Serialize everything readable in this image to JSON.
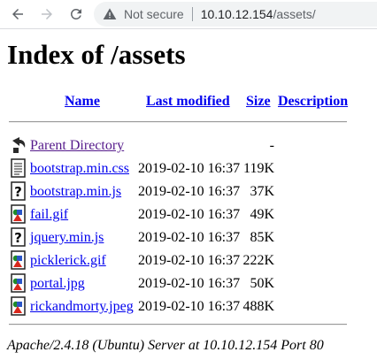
{
  "browser": {
    "security_label": "Not secure",
    "url_host": "10.10.12.154",
    "url_path": "/assets/"
  },
  "page": {
    "title": "Index of /assets",
    "columns": {
      "name": "Name",
      "last_modified": "Last modified",
      "size": "Size",
      "description": "Description"
    },
    "parent": {
      "label": "Parent Directory",
      "size": "-",
      "icon": "back-icon"
    },
    "files": [
      {
        "name": "bootstrap.min.css",
        "modified": "2019-02-10 16:37",
        "size": "119K",
        "icon": "text-file-icon"
      },
      {
        "name": "bootstrap.min.js",
        "modified": "2019-02-10 16:37",
        "size": "37K",
        "icon": "unknown-file-icon"
      },
      {
        "name": "fail.gif",
        "modified": "2019-02-10 16:37",
        "size": "49K",
        "icon": "image-file-icon"
      },
      {
        "name": "jquery.min.js",
        "modified": "2019-02-10 16:37",
        "size": "85K",
        "icon": "unknown-file-icon"
      },
      {
        "name": "picklerick.gif",
        "modified": "2019-02-10 16:37",
        "size": "222K",
        "icon": "image-file-icon"
      },
      {
        "name": "portal.jpg",
        "modified": "2019-02-10 16:37",
        "size": "50K",
        "icon": "image-file-icon"
      },
      {
        "name": "rickandmorty.jpeg",
        "modified": "2019-02-10 16:37",
        "size": "488K",
        "icon": "image-file-icon"
      }
    ],
    "footer": "Apache/2.4.18 (Ubuntu) Server at 10.10.12.154 Port 80"
  },
  "colors": {
    "link": "#0000ee",
    "visited_link": "#551a8b",
    "toolbar_icon": "#5f6368"
  }
}
